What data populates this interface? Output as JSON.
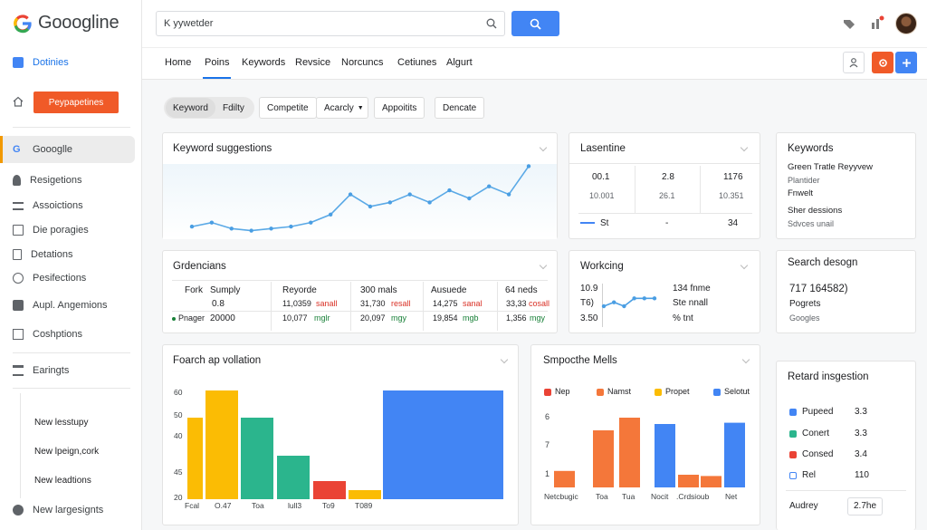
{
  "app": {
    "title": "Gooogline"
  },
  "search": {
    "value": "K yywetder"
  },
  "sidebar": {
    "top_item": "Dotinies",
    "button": "Peypapetines",
    "active_item": "Goooglle",
    "items": [
      "Resigetions",
      "Assoictions",
      "Die poragies",
      "Detations",
      "Pesifections",
      "Aupl. Angemions",
      "Coshptions",
      "Earingts"
    ],
    "lower_items": [
      "New lesstupy",
      "New lpeign,cork",
      "New leadtions",
      "New largesignts"
    ]
  },
  "tabs": [
    "Home",
    "Poins",
    "Keywords",
    "Revsice",
    "Norcuncs",
    "Cetiunes",
    "Algurt"
  ],
  "filters": [
    "Keyword",
    "Fdilty",
    "Competite",
    "Acarcly",
    "Appoitits",
    "Dencate"
  ],
  "cards": {
    "keyword_suggestions": {
      "title": "Keyword suggestions",
      "chart_data": {
        "type": "line",
        "values": [
          2,
          3,
          1.5,
          1,
          1.5,
          2,
          3,
          5,
          10,
          7,
          8,
          10,
          8,
          11,
          9,
          12,
          10,
          17
        ]
      }
    },
    "lasentine": {
      "title": "Lasentine",
      "row1": [
        "00.1",
        "2.8",
        "1176"
      ],
      "row2": [
        "10.001",
        "26.1",
        "10.351"
      ],
      "row3": [
        "St",
        "-",
        "34"
      ]
    },
    "keywords": {
      "title": "Keywords",
      "lines": [
        "Green Tratle Reyyvew",
        "Plantider",
        "Fnwelt",
        "Sher dessions",
        "Sdvces unail"
      ]
    },
    "gardencians": {
      "title": "Grdencians",
      "headers": [
        "Fork",
        "Sumply",
        "Reyorde",
        "300 mals",
        "Ausuede",
        "64 neds"
      ],
      "row1": [
        "0.8",
        "11,0359",
        "sanall",
        "31,730",
        "resall",
        "14,275",
        "sanal",
        "33,33",
        "cosall"
      ],
      "row2_label": "Pnager",
      "row2": [
        "20000",
        "10,077",
        "mglr",
        "20,097",
        "mgy",
        "19,854",
        "mgb",
        "1,356",
        "mgy"
      ]
    },
    "working": {
      "title": "Workcing",
      "left": [
        "10.9",
        "T6)",
        "3.50"
      ],
      "right": [
        "134 fnme",
        "Ste nnall",
        "% tnt"
      ],
      "chart_data": {
        "type": "line",
        "values": [
          3,
          4,
          3,
          5,
          5,
          5
        ]
      }
    },
    "search_design": {
      "title": "Search desogn",
      "value": "717 164582)",
      "line1": "Pogrets",
      "line2": "Googles"
    },
    "foarch": {
      "title": "Foarch ap vollation",
      "chart_data": {
        "type": "bar",
        "ytick_labels": [
          "60",
          "50",
          "40",
          "45",
          "20"
        ],
        "xtick_labels": [
          "Fcal",
          "O.47",
          "Toa",
          "lull3",
          "To9",
          "T089"
        ],
        "values": [
          45,
          60,
          45,
          24,
          10,
          5,
          60
        ],
        "colors": [
          "#fbbc04",
          "#fbbc04",
          "#2bb58d",
          "#2bb58d",
          "#ea4335",
          "#fbbc04",
          "#4285f4"
        ]
      }
    },
    "smpothe": {
      "title": "Smpocthe Mells",
      "legend": [
        {
          "name": "Nep",
          "color": "#ea4335"
        },
        {
          "name": "Namst",
          "color": "#f4773a"
        },
        {
          "name": "Propet",
          "color": "#fbbc04"
        },
        {
          "name": "Selotut",
          "color": "#4285f4"
        }
      ],
      "chart_data": {
        "type": "bar",
        "ytick_labels": [
          "6",
          "7",
          "1"
        ],
        "xtick_labels": [
          "Netcbugic",
          "Toa",
          "Tua",
          "Nocit",
          ".Crdsioub",
          "Net"
        ],
        "values": [
          1.3,
          4.5,
          5.5,
          5,
          1.0,
          0.9,
          5.1
        ],
        "colors": [
          "#f4773a",
          "#f4773a",
          "#f4773a",
          "#4285f4",
          "#f4773a",
          "#f4773a",
          "#4285f4"
        ]
      }
    },
    "retard": {
      "title": "Retard insgestion",
      "items": [
        {
          "label": "Pupeed",
          "value": "3.3",
          "color": "#4285f4"
        },
        {
          "label": "Conert",
          "value": "3.3",
          "color": "#2bb58d"
        },
        {
          "label": "Consed",
          "value": "3.4",
          "color": "#ea4335"
        },
        {
          "label": "Rel",
          "value": "110",
          "color": "#4285f4"
        }
      ],
      "footer_label": "Audrey",
      "footer_value": "2.7he"
    }
  }
}
